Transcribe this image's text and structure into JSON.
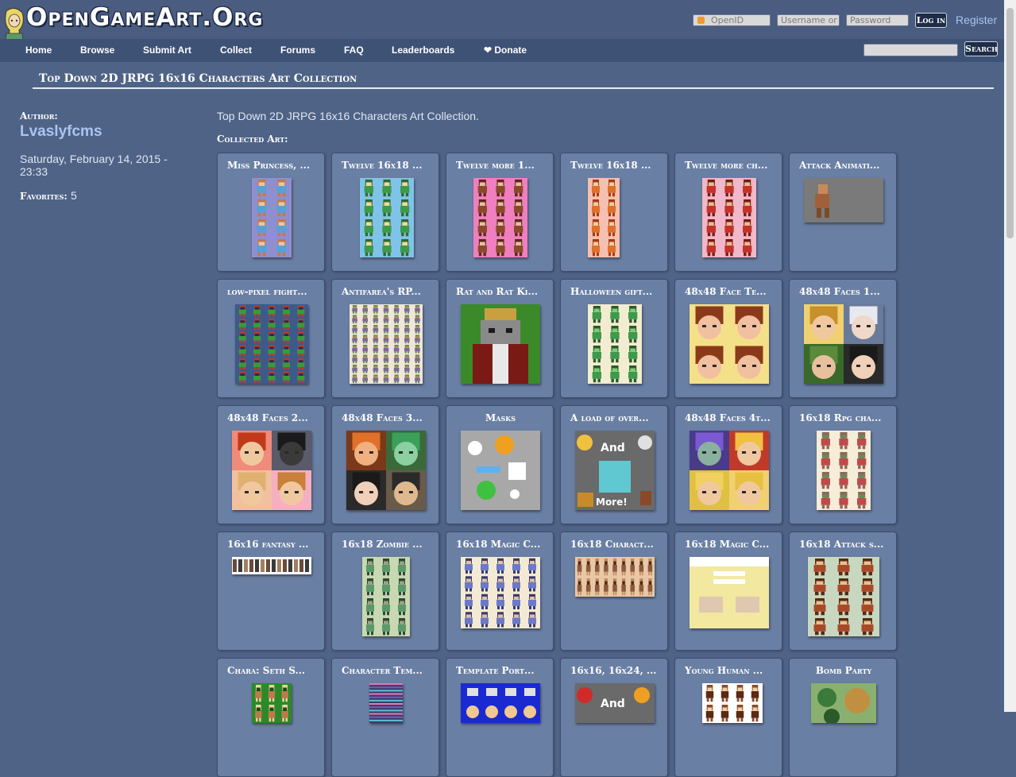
{
  "site": {
    "title": "OpenGameArt.Org",
    "openid_placeholder": "OpenID",
    "username_placeholder": "Username or",
    "password_placeholder": "Password",
    "login_label": "Log in",
    "register_label": "Register",
    "search_label": "Search"
  },
  "nav": [
    "Home",
    "Browse",
    "Submit Art",
    "Collect",
    "Forums",
    "FAQ",
    "Leaderboards",
    "❤ Donate"
  ],
  "page": {
    "title": "Top Down 2D JRPG 16x16 Characters Art Collection",
    "description": "Top Down 2D JRPG 16x16 Characters Art Collection.",
    "collected_label": "Collected Art:"
  },
  "sidebar": {
    "author_label": "Author:",
    "author_name": "Lvaslyfcms",
    "date": "Saturday, February 14, 2015 - 23:33",
    "favorites_label": "Favorites:",
    "favorites_count": "5"
  },
  "art_items": [
    "Miss Princess, ...",
    "Twelve 16x18 ...",
    "Twelve more 1...",
    "Twelve 16x18 ...",
    "Twelve more ch...",
    "Attack Animati...",
    "low-pixel fight...",
    "Antifarea's RP...",
    "Rat and Rat Ki...",
    "Halloween gift...",
    "48x48 Face Te...",
    "48x48 Faces 1...",
    "48x48 Faces 2...",
    "48x48 Faces 3...",
    "Masks",
    "A load of over...",
    "48x48 Faces 4t...",
    "16x18 Rpg cha...",
    "16x16 fantasy ...",
    "16x18 Zombie ...",
    "16x18 Magic C...",
    "16x18 Charact...",
    "16x18 Magic C...",
    "16x18 Attack s...",
    "Chara: Seth S...",
    "Character Tem...",
    "Template Port...",
    "16x16, 16x24, ...",
    "Young Human ...",
    "Bomb Party"
  ],
  "thumb_text": {
    "and": "And",
    "more": "More!"
  },
  "colors": {
    "page_background": "#4f6387",
    "header_background": "#4a5c80",
    "nav_background": "#3e5276",
    "tile_background": "#6a7fa4",
    "link": "#a9c6f0"
  }
}
